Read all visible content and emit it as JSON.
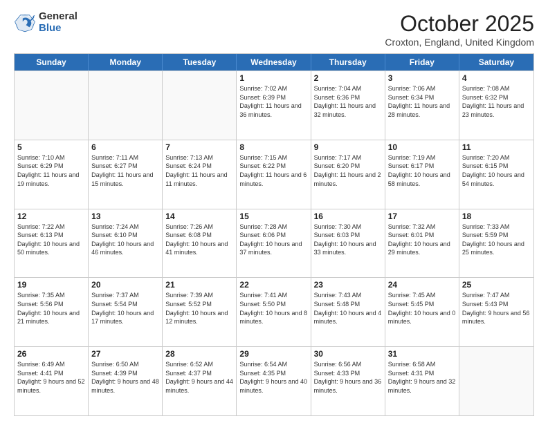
{
  "logo": {
    "general": "General",
    "blue": "Blue"
  },
  "header": {
    "month": "October 2025",
    "location": "Croxton, England, United Kingdom"
  },
  "weekdays": [
    "Sunday",
    "Monday",
    "Tuesday",
    "Wednesday",
    "Thursday",
    "Friday",
    "Saturday"
  ],
  "weeks": [
    [
      {
        "day": "",
        "empty": true
      },
      {
        "day": "",
        "empty": true
      },
      {
        "day": "",
        "empty": true
      },
      {
        "day": "1",
        "sunrise": "7:02 AM",
        "sunset": "6:39 PM",
        "daylight": "11 hours and 36 minutes."
      },
      {
        "day": "2",
        "sunrise": "7:04 AM",
        "sunset": "6:36 PM",
        "daylight": "11 hours and 32 minutes."
      },
      {
        "day": "3",
        "sunrise": "7:06 AM",
        "sunset": "6:34 PM",
        "daylight": "11 hours and 28 minutes."
      },
      {
        "day": "4",
        "sunrise": "7:08 AM",
        "sunset": "6:32 PM",
        "daylight": "11 hours and 23 minutes."
      }
    ],
    [
      {
        "day": "5",
        "sunrise": "7:10 AM",
        "sunset": "6:29 PM",
        "daylight": "11 hours and 19 minutes."
      },
      {
        "day": "6",
        "sunrise": "7:11 AM",
        "sunset": "6:27 PM",
        "daylight": "11 hours and 15 minutes."
      },
      {
        "day": "7",
        "sunrise": "7:13 AM",
        "sunset": "6:24 PM",
        "daylight": "11 hours and 11 minutes."
      },
      {
        "day": "8",
        "sunrise": "7:15 AM",
        "sunset": "6:22 PM",
        "daylight": "11 hours and 6 minutes."
      },
      {
        "day": "9",
        "sunrise": "7:17 AM",
        "sunset": "6:20 PM",
        "daylight": "11 hours and 2 minutes."
      },
      {
        "day": "10",
        "sunrise": "7:19 AM",
        "sunset": "6:17 PM",
        "daylight": "10 hours and 58 minutes."
      },
      {
        "day": "11",
        "sunrise": "7:20 AM",
        "sunset": "6:15 PM",
        "daylight": "10 hours and 54 minutes."
      }
    ],
    [
      {
        "day": "12",
        "sunrise": "7:22 AM",
        "sunset": "6:13 PM",
        "daylight": "10 hours and 50 minutes."
      },
      {
        "day": "13",
        "sunrise": "7:24 AM",
        "sunset": "6:10 PM",
        "daylight": "10 hours and 46 minutes."
      },
      {
        "day": "14",
        "sunrise": "7:26 AM",
        "sunset": "6:08 PM",
        "daylight": "10 hours and 41 minutes."
      },
      {
        "day": "15",
        "sunrise": "7:28 AM",
        "sunset": "6:06 PM",
        "daylight": "10 hours and 37 minutes."
      },
      {
        "day": "16",
        "sunrise": "7:30 AM",
        "sunset": "6:03 PM",
        "daylight": "10 hours and 33 minutes."
      },
      {
        "day": "17",
        "sunrise": "7:32 AM",
        "sunset": "6:01 PM",
        "daylight": "10 hours and 29 minutes."
      },
      {
        "day": "18",
        "sunrise": "7:33 AM",
        "sunset": "5:59 PM",
        "daylight": "10 hours and 25 minutes."
      }
    ],
    [
      {
        "day": "19",
        "sunrise": "7:35 AM",
        "sunset": "5:56 PM",
        "daylight": "10 hours and 21 minutes."
      },
      {
        "day": "20",
        "sunrise": "7:37 AM",
        "sunset": "5:54 PM",
        "daylight": "10 hours and 17 minutes."
      },
      {
        "day": "21",
        "sunrise": "7:39 AM",
        "sunset": "5:52 PM",
        "daylight": "10 hours and 12 minutes."
      },
      {
        "day": "22",
        "sunrise": "7:41 AM",
        "sunset": "5:50 PM",
        "daylight": "10 hours and 8 minutes."
      },
      {
        "day": "23",
        "sunrise": "7:43 AM",
        "sunset": "5:48 PM",
        "daylight": "10 hours and 4 minutes."
      },
      {
        "day": "24",
        "sunrise": "7:45 AM",
        "sunset": "5:45 PM",
        "daylight": "10 hours and 0 minutes."
      },
      {
        "day": "25",
        "sunrise": "7:47 AM",
        "sunset": "5:43 PM",
        "daylight": "9 hours and 56 minutes."
      }
    ],
    [
      {
        "day": "26",
        "sunrise": "6:49 AM",
        "sunset": "4:41 PM",
        "daylight": "9 hours and 52 minutes."
      },
      {
        "day": "27",
        "sunrise": "6:50 AM",
        "sunset": "4:39 PM",
        "daylight": "9 hours and 48 minutes."
      },
      {
        "day": "28",
        "sunrise": "6:52 AM",
        "sunset": "4:37 PM",
        "daylight": "9 hours and 44 minutes."
      },
      {
        "day": "29",
        "sunrise": "6:54 AM",
        "sunset": "4:35 PM",
        "daylight": "9 hours and 40 minutes."
      },
      {
        "day": "30",
        "sunrise": "6:56 AM",
        "sunset": "4:33 PM",
        "daylight": "9 hours and 36 minutes."
      },
      {
        "day": "31",
        "sunrise": "6:58 AM",
        "sunset": "4:31 PM",
        "daylight": "9 hours and 32 minutes."
      },
      {
        "day": "",
        "empty": true
      }
    ]
  ]
}
